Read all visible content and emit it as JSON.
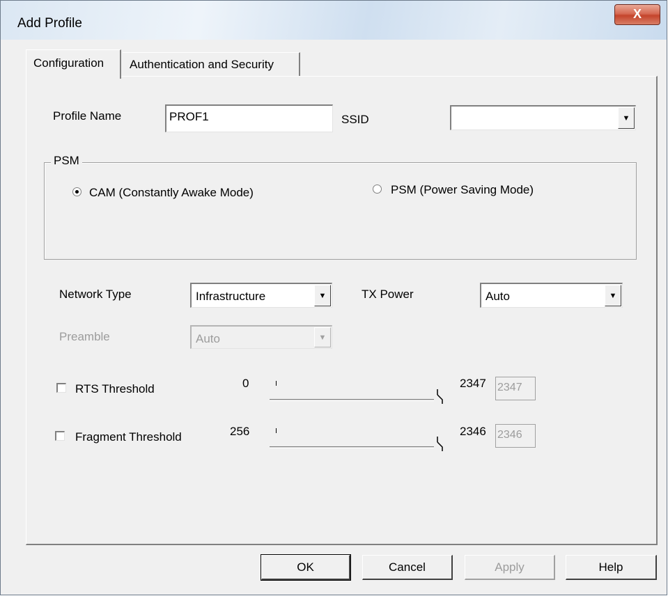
{
  "window": {
    "title": "Add Profile",
    "close_label": "X"
  },
  "tabs": [
    {
      "label": "Configuration"
    },
    {
      "label": "Authentication and Security"
    }
  ],
  "config": {
    "profile_name_label": "Profile Name",
    "profile_name_value": "PROF1",
    "ssid_label": "SSID",
    "ssid_value": "",
    "psm_group_title": "PSM",
    "cam_label": "CAM (Constantly Awake Mode)",
    "psm_label": "PSM (Power Saving Mode)",
    "network_type_label": "Network Type",
    "network_type_value": "Infrastructure",
    "tx_power_label": "TX Power",
    "tx_power_value": "Auto",
    "preamble_label": "Preamble",
    "preamble_value": "Auto",
    "rts_label": "RTS Threshold",
    "rts_min": "0",
    "rts_max": "2347",
    "rts_value": "2347",
    "frag_label": "Fragment Threshold",
    "frag_min": "256",
    "frag_max": "2346",
    "frag_value": "2346"
  },
  "buttons": {
    "ok": "OK",
    "cancel": "Cancel",
    "apply": "Apply",
    "help": "Help"
  },
  "colors": {
    "accent": "#d66a53"
  },
  "icons": {
    "close": "close-icon",
    "dropdown": "chevron-down-icon"
  }
}
